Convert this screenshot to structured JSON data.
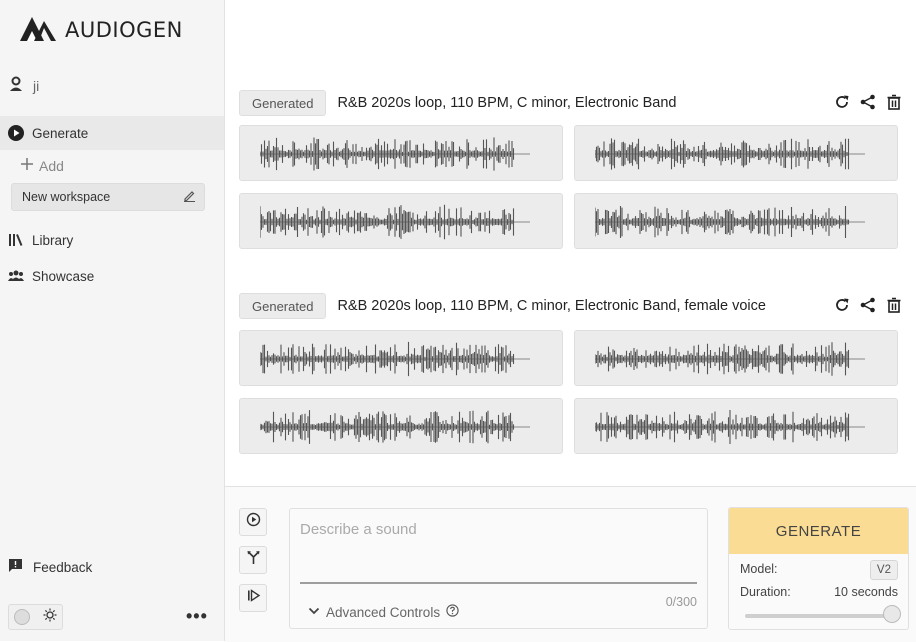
{
  "app": {
    "brand": "AUDIOGEN"
  },
  "user": {
    "name": "ji"
  },
  "sidebar": {
    "generate_label": "Generate",
    "add_label": "Add",
    "workspace_label": "New workspace",
    "library_label": "Library",
    "showcase_label": "Showcase",
    "feedback_label": "Feedback"
  },
  "groups": [
    {
      "badge": "Generated",
      "prompt": "R&B 2020s loop, 110 BPM, C minor, Electronic Band"
    },
    {
      "badge": "Generated",
      "prompt": "R&B 2020s loop, 110 BPM, C minor, Electronic Band, female voice"
    }
  ],
  "composer": {
    "placeholder": "Describe a sound",
    "counter": "0/300",
    "advanced_label": "Advanced Controls"
  },
  "generate": {
    "button_label": "GENERATE",
    "model_label": "Model:",
    "model_value": "V2",
    "duration_label": "Duration:",
    "duration_value": "10 seconds",
    "duration_slider_fraction": 1.0
  },
  "colors": {
    "accent": "#fbdc94",
    "waveform": "#555555",
    "tile_bg": "#ececec"
  },
  "icons": [
    "logo-icon",
    "user-icon",
    "play-circle-icon",
    "plus-icon",
    "edit-icon",
    "library-icon",
    "people-icon",
    "feedback-icon",
    "sun-icon",
    "more-icon",
    "refresh-icon",
    "share-icon",
    "trash-icon",
    "text-to-audio-icon",
    "branch-icon",
    "continue-icon",
    "chevron-down-icon",
    "help-icon"
  ]
}
